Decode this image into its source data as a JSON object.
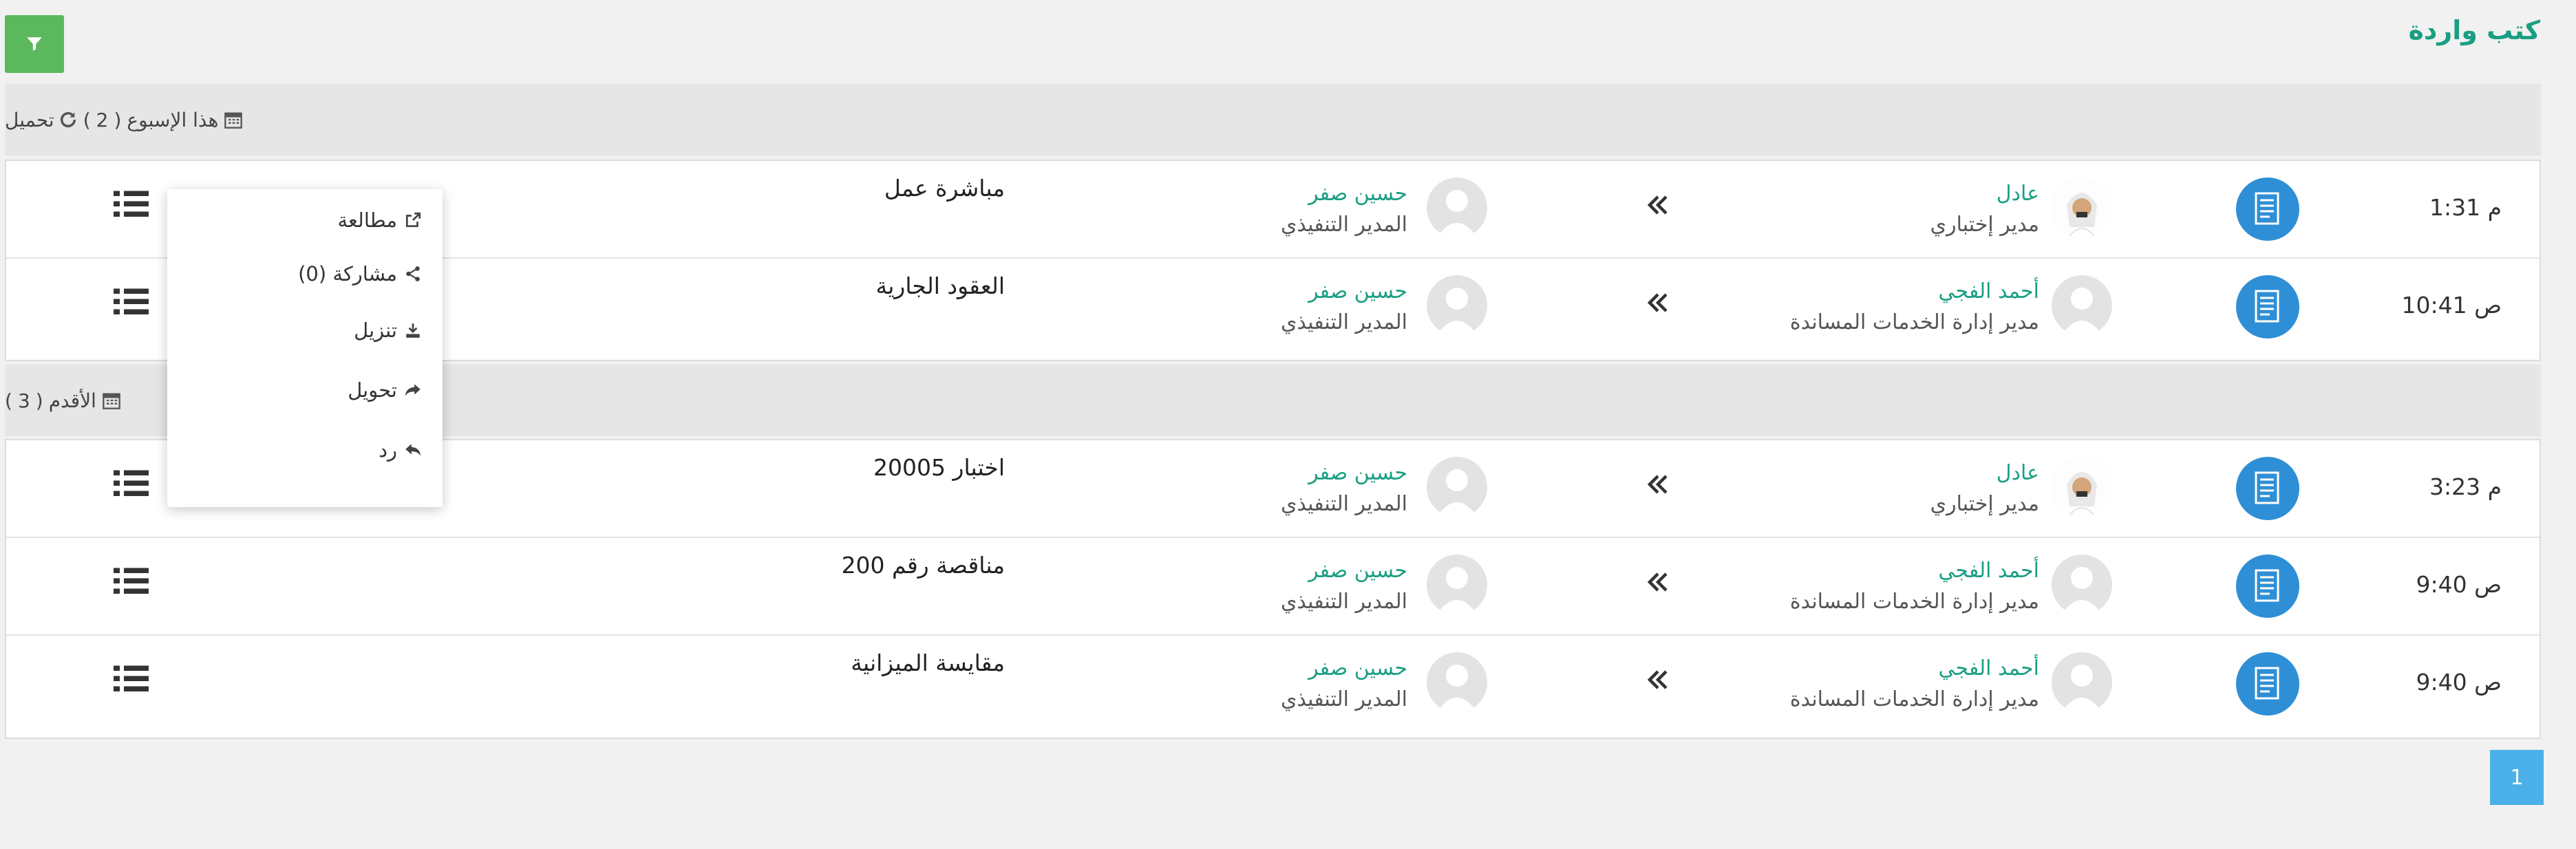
{
  "title": "كتب واردة",
  "groups": {
    "week": {
      "label": "هذا الإسبوع",
      "count": "2",
      "load": "تحميل"
    },
    "older": {
      "label": "الأقدم",
      "count": "3"
    }
  },
  "rows": [
    {
      "time": "1:31 م",
      "sender_name": "عادل",
      "sender_role": "مدير إختباري",
      "receiver_name": "حسين صفر",
      "receiver_role": "المدير التنفيذي",
      "subject": "مباشرة عمل"
    },
    {
      "time": "10:41 ص",
      "sender_name": "أحمد الفجي",
      "sender_role": "مدير إدارة الخدمات المساندة",
      "receiver_name": "حسين صفر",
      "receiver_role": "المدير التنفيذي",
      "subject": "العقود الجارية"
    },
    {
      "time": "3:23 م",
      "sender_name": "عادل",
      "sender_role": "مدير إختباري",
      "receiver_name": "حسين صفر",
      "receiver_role": "المدير التنفيذي",
      "subject": "اختبار 20005"
    },
    {
      "time": "9:40 ص",
      "sender_name": "أحمد الفجي",
      "sender_role": "مدير إدارة الخدمات المساندة",
      "receiver_name": "حسين صفر",
      "receiver_role": "المدير التنفيذي",
      "subject": "مناقصة رقم 200"
    },
    {
      "time": "9:40 ص",
      "sender_name": "أحمد الفجي",
      "sender_role": "مدير إدارة الخدمات المساندة",
      "receiver_name": "حسين صفر",
      "receiver_role": "المدير التنفيذي",
      "subject": "مقايسة الميزانية"
    }
  ],
  "menu": {
    "read": "مطالعة",
    "share": "مشاركة (0)",
    "download": "تنزيل",
    "forward": "تحويل",
    "reply": "رد"
  },
  "pagination": {
    "current": "1"
  },
  "colors": {
    "accent": "#1a9e83",
    "filter": "#5cb85c",
    "doc_icon": "#2e8fd6",
    "pager": "#4bb0e8"
  }
}
